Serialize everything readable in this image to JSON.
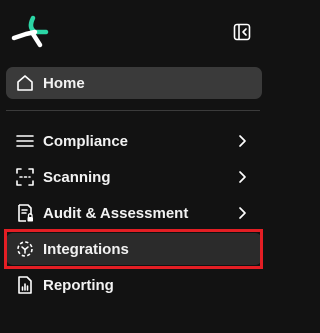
{
  "sidebar": {
    "logo_icon": "brand-logo-icon",
    "collapse_icon": "collapse-sidebar-icon",
    "accent_color": "#2bd6a5",
    "highlight_color": "#e31e24",
    "items": [
      {
        "label": "Home",
        "icon": "home-icon",
        "selected": true
      },
      {
        "label": "Compliance",
        "icon": "menu-lines-icon",
        "has_submenu": true
      },
      {
        "label": "Scanning",
        "icon": "scan-icon",
        "has_submenu": true
      },
      {
        "label": "Audit & Assessment",
        "icon": "audit-document-icon",
        "has_submenu": true
      },
      {
        "label": "Integrations",
        "icon": "integrations-icon",
        "highlighted": true
      },
      {
        "label": "Reporting",
        "icon": "report-icon"
      }
    ]
  }
}
